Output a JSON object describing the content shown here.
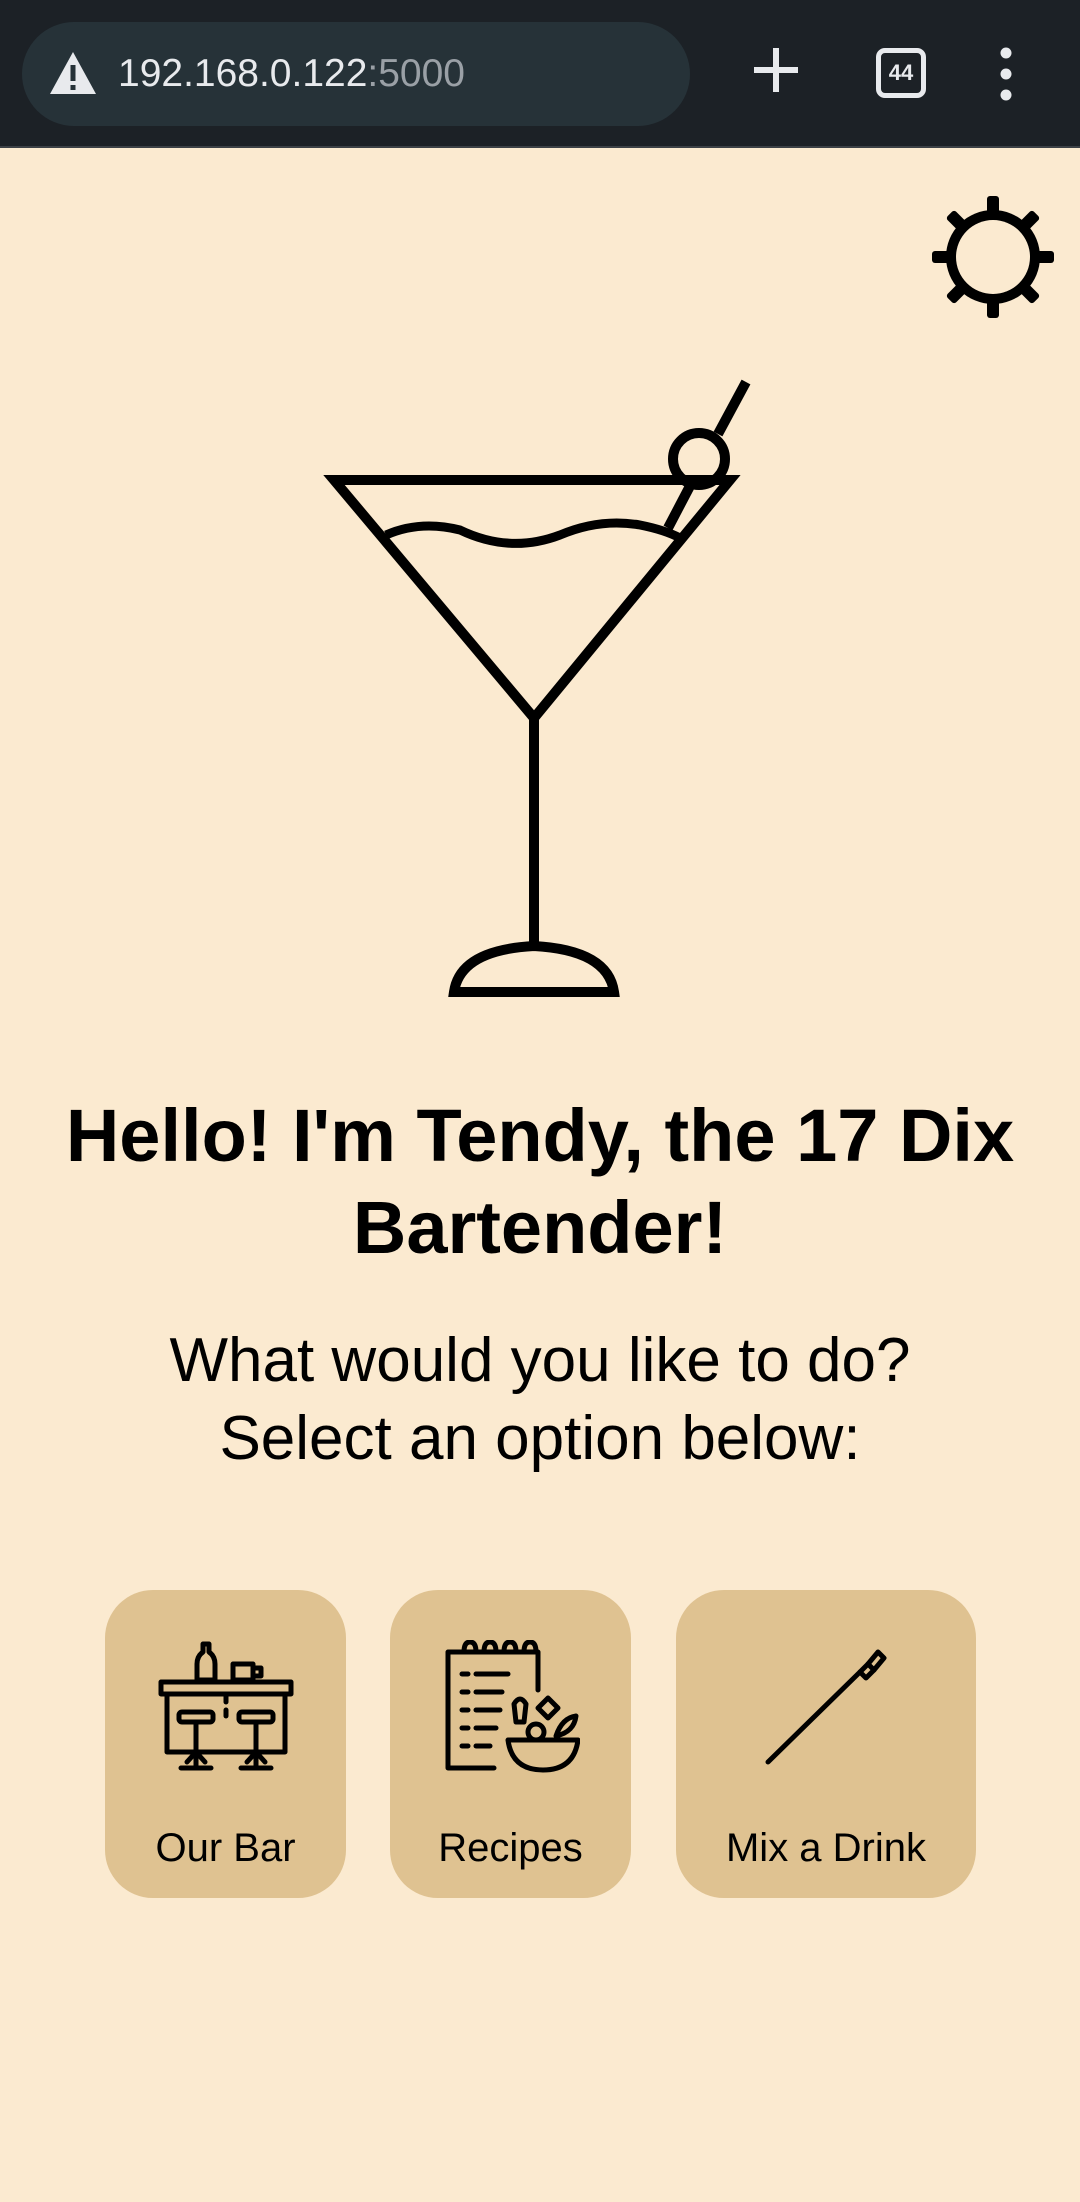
{
  "browser": {
    "url_host": "192.168.0.122",
    "url_port": ":5000",
    "tab_count": "44"
  },
  "header": {
    "settings_icon": "gear-icon"
  },
  "hero": {
    "icon": "martini-glass-icon",
    "greeting": "Hello! I'm Tendy, the 17 Dix Bartender!",
    "prompt_line1": "What would you like to do?",
    "prompt_line2": "Select an option below:"
  },
  "options": [
    {
      "icon": "bar-counter-icon",
      "label": "Our Bar"
    },
    {
      "icon": "recipe-book-icon",
      "label": "Recipes"
    },
    {
      "icon": "stirrer-icon",
      "label": "Mix a Drink"
    }
  ],
  "colors": {
    "page_background": "#fbead0",
    "card_background": "#dfc291",
    "browser_bar": "#1c2126",
    "url_pill": "#263238",
    "text": "#000000"
  }
}
